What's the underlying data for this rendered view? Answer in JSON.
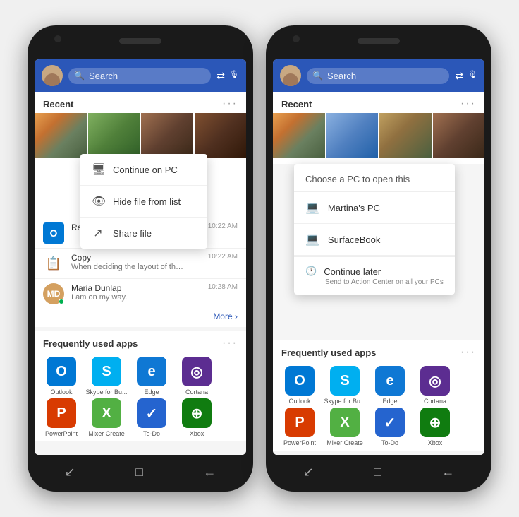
{
  "phone1": {
    "header": {
      "search_placeholder": "Search",
      "transfer_icon": "⇄",
      "mic_icon": "🎤"
    },
    "recent_section": {
      "title": "Recent",
      "dots": "···"
    },
    "images": [
      {
        "id": "img1",
        "type": "landscape"
      },
      {
        "id": "img2",
        "type": "green"
      },
      {
        "id": "img3",
        "type": "dark"
      },
      {
        "id": "img4",
        "type": "coffee"
      }
    ],
    "context_menu": {
      "items": [
        {
          "icon": "🖥",
          "label": "Continue on PC"
        },
        {
          "icon": "👁",
          "label": "Hide file from list"
        },
        {
          "icon": "↗",
          "label": "Share file"
        }
      ]
    },
    "activity_items": [
      {
        "type": "outlook",
        "title": "Re: Q4 Status Review",
        "subtitle": "",
        "time": "10:22 AM"
      },
      {
        "type": "copy",
        "title": "Copy",
        "subtitle": "When deciding the layout of the do...",
        "time": "10:22 AM"
      },
      {
        "type": "person",
        "title": "Maria Dunlap",
        "subtitle": "I am on my way.",
        "time": "10:28 AM"
      }
    ],
    "more_label": "More",
    "apps_section": {
      "title": "Frequently used apps",
      "dots": "···",
      "apps": [
        {
          "label": "Outlook",
          "class": "app-outlook",
          "icon": "O"
        },
        {
          "label": "Skype for Bu...",
          "class": "app-skype",
          "icon": "S"
        },
        {
          "label": "Edge",
          "class": "app-edge",
          "icon": "e"
        },
        {
          "label": "Cortana",
          "class": "app-cortana",
          "icon": "◎"
        },
        {
          "label": "PowerPoint",
          "class": "app-powerpoint",
          "icon": "P"
        },
        {
          "label": "Mixer Create",
          "class": "app-mixer",
          "icon": "X"
        },
        {
          "label": "To-Do",
          "class": "app-todo",
          "icon": "✓"
        },
        {
          "label": "Xbox",
          "class": "app-xbox",
          "icon": "⊕"
        }
      ]
    },
    "nav": [
      "↙",
      "□",
      "←"
    ]
  },
  "phone2": {
    "header": {
      "search_placeholder": "Search"
    },
    "recent_section": {
      "title": "Recent",
      "dots": "···"
    },
    "pc_menu": {
      "title": "Choose a PC to open this",
      "items": [
        {
          "icon": "💻",
          "label": "Martina's PC"
        },
        {
          "icon": "💻",
          "label": "SurfaceBook"
        }
      ],
      "continue_later": {
        "icon": "🕐",
        "title": "Continue later",
        "subtitle": "Send to Action Center on all your PCs"
      }
    },
    "apps_section": {
      "title": "Frequently used apps",
      "dots": "···",
      "apps": [
        {
          "label": "Outlook",
          "class": "app-outlook",
          "icon": "O"
        },
        {
          "label": "Skype for Bu...",
          "class": "app-skype",
          "icon": "S"
        },
        {
          "label": "Edge",
          "class": "app-edge",
          "icon": "e"
        },
        {
          "label": "Cortana",
          "class": "app-cortana",
          "icon": "◎"
        },
        {
          "label": "PowerPoint",
          "class": "app-powerpoint",
          "icon": "P"
        },
        {
          "label": "Mixer Create",
          "class": "app-mixer",
          "icon": "X"
        },
        {
          "label": "To-Do",
          "class": "app-todo",
          "icon": "✓"
        },
        {
          "label": "Xbox",
          "class": "app-xbox",
          "icon": "⊕"
        }
      ]
    },
    "nav": [
      "↙",
      "□",
      "←"
    ]
  }
}
